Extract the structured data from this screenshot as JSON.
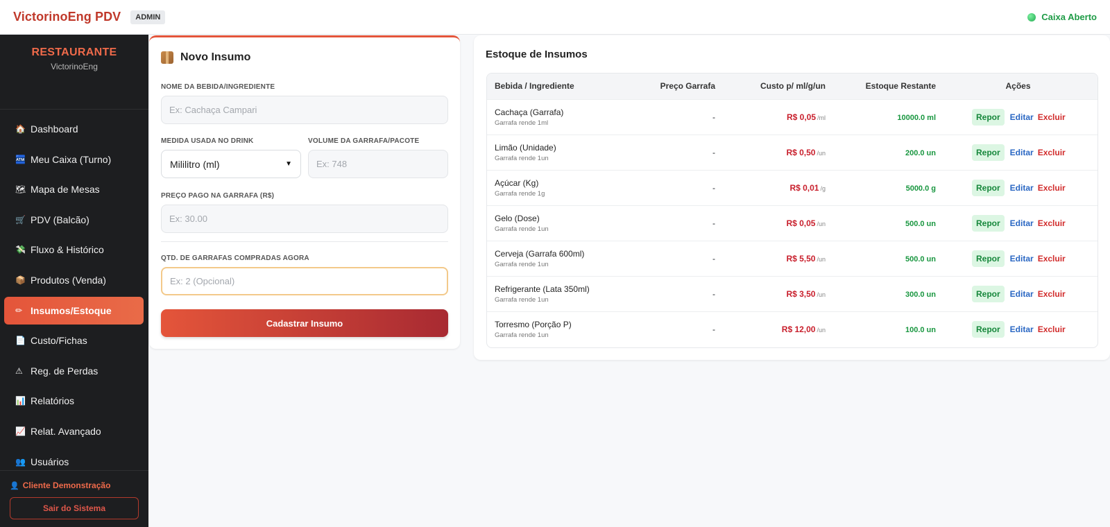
{
  "topbar": {
    "brand": "VictorinoEng PDV",
    "role": "ADMIN",
    "cash_status": "Caixa Aberto",
    "cash_status_color": "#1e9b46"
  },
  "sidebar": {
    "title": "RESTAURANTE",
    "subtitle": "VictorinoEng",
    "items": [
      {
        "icon": "🏠",
        "icon_name": "house-icon",
        "label": "Dashboard"
      },
      {
        "icon": "🏧",
        "icon_name": "atm-icon",
        "label": "Meu Caixa (Turno)"
      },
      {
        "icon": "🗺",
        "icon_name": "map-icon",
        "label": "Mapa de Mesas"
      },
      {
        "icon": "🛒",
        "icon_name": "cart-icon",
        "label": "PDV (Balcão)"
      },
      {
        "icon": "💸",
        "icon_name": "money-flow-icon",
        "label": "Fluxo & Histórico"
      },
      {
        "icon": "📦",
        "icon_name": "package-icon",
        "label": "Produtos (Venda)"
      },
      {
        "icon": "✏",
        "icon_name": "pencil-icon",
        "label": "Insumos/Estoque",
        "active": true
      },
      {
        "icon": "📄",
        "icon_name": "document-icon",
        "label": "Custo/Fichas"
      },
      {
        "icon": "⚠",
        "icon_name": "warning-icon",
        "label": "Reg. de Perdas"
      },
      {
        "icon": "📊",
        "icon_name": "bar-chart-icon",
        "label": "Relatórios"
      },
      {
        "icon": "📈",
        "icon_name": "line-chart-icon",
        "label": "Relat. Avançado"
      },
      {
        "icon": "👥",
        "icon_name": "users-icon",
        "label": "Usuários"
      }
    ],
    "client": "Cliente Demonstração",
    "logout": "Sair do Sistema",
    "accent": "#e4553a"
  },
  "form": {
    "title": "Novo Insumo",
    "name_label": "NOME DA BEBIDA/INGREDIENTE",
    "name_placeholder": "Ex: Cachaça Campari",
    "measure_label": "MEDIDA USADA NO DRINK",
    "measure_value": "Mililitro (ml)",
    "volume_label": "VOLUME DA GARRAFA/PACOTE",
    "volume_placeholder": "Ex: 748",
    "price_label": "PREÇO PAGO NA GARRAFA (R$)",
    "price_placeholder": "Ex: 30.00",
    "qty_label": "QTD. DE GARRAFAS COMPRADAS AGORA",
    "qty_placeholder": "Ex: 2 (Opcional)",
    "submit": "Cadastrar Insumo"
  },
  "stock": {
    "title": "Estoque de Insumos",
    "columns": [
      "Bebida / Ingrediente",
      "Preço Garrafa",
      "Custo p/ ml/g/un",
      "Estoque Restante",
      "Ações"
    ],
    "actions": {
      "restock": "Repor",
      "edit": "Editar",
      "delete": "Excluir"
    },
    "rows": [
      {
        "name": "Cachaça (Garrafa)",
        "sub": "Garrafa rende 1ml",
        "price": "-",
        "cost": "R$ 0,05",
        "cost_unit": "/ml",
        "stock": "10000.0 ml"
      },
      {
        "name": "Limão (Unidade)",
        "sub": "Garrafa rende 1un",
        "price": "-",
        "cost": "R$ 0,50",
        "cost_unit": "/un",
        "stock": "200.0 un"
      },
      {
        "name": "Açúcar (Kg)",
        "sub": "Garrafa rende 1g",
        "price": "-",
        "cost": "R$ 0,01",
        "cost_unit": "/g",
        "stock": "5000.0 g"
      },
      {
        "name": "Gelo (Dose)",
        "sub": "Garrafa rende 1un",
        "price": "-",
        "cost": "R$ 0,05",
        "cost_unit": "/un",
        "stock": "500.0 un"
      },
      {
        "name": "Cerveja (Garrafa 600ml)",
        "sub": "Garrafa rende 1un",
        "price": "-",
        "cost": "R$ 5,50",
        "cost_unit": "/un",
        "stock": "500.0 un"
      },
      {
        "name": "Refrigerante (Lata 350ml)",
        "sub": "Garrafa rende 1un",
        "price": "-",
        "cost": "R$ 3,50",
        "cost_unit": "/un",
        "stock": "300.0 un"
      },
      {
        "name": "Torresmo (Porção P)",
        "sub": "Garrafa rende 1un",
        "price": "-",
        "cost": "R$ 12,00",
        "cost_unit": "/un",
        "stock": "100.0 un"
      }
    ]
  }
}
